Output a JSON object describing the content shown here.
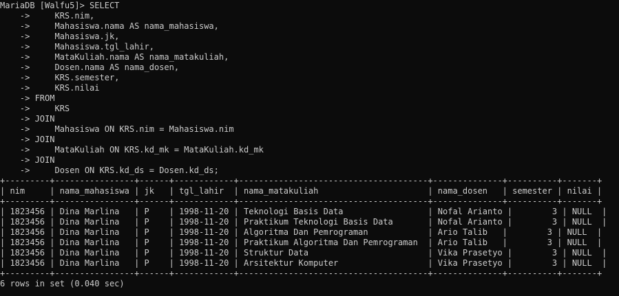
{
  "terminal": {
    "prompt": "MariaDB [Walfu5]> SELECT",
    "query_lines": [
      "    ->     KRS.nim,",
      "    ->     Mahasiswa.nama AS nama_mahasiswa,",
      "    ->     Mahasiswa.jk,",
      "    ->     Mahasiswa.tgl_lahir,",
      "    ->     MataKuliah.nama AS nama_matakuliah,",
      "    ->     Dosen.nama AS nama_dosen,",
      "    ->     KRS.semester,",
      "    ->     KRS.nilai",
      "    -> FROM",
      "    ->     KRS",
      "    -> JOIN",
      "    ->     Mahasiswa ON KRS.nim = Mahasiswa.nim",
      "    -> JOIN",
      "    ->     MataKuliah ON KRS.kd_mk = MataKuliah.kd_mk",
      "    -> JOIN",
      "    ->     Dosen ON KRS.kd_ds = Dosen.kd_ds;"
    ],
    "table_border": "+---------+----------------+------+------------+--------------------------------------+--------------+----------+-------+",
    "table_header": "| nim     | nama_mahasiswa | jk   | tgl_lahir  | nama_matakuliah                      | nama_dosen   | semester | nilai |",
    "table_rows": [
      "| 1823456 | Dina Marlina   | P    | 1998-11-20 | Teknologi Basis Data                 | Nofal Arianto |        3 | NULL  |",
      "| 1823456 | Dina Marlina   | P    | 1998-11-20 | Praktikum Teknologi Basis Data       | Nofal Arianto |        3 | NULL  |",
      "| 1823456 | Dina Marlina   | P    | 1998-11-20 | Algoritma Dan Pemrograman            | Ario Talib   |        3 | NULL  |",
      "| 1823456 | Dina Marlina   | P    | 1998-11-20 | Praktikum Algoritma Dan Pemrograman  | Ario Talib   |        3 | NULL  |",
      "| 1823456 | Dina Marlina   | P    | 1998-11-20 | Struktur Data                        | Vika Prasetyo |        3 | NULL  |",
      "| 1823456 | Dina Marlina   | P    | 1998-11-20 | Arsitektur Komputer                  | Vika Prasetyo |        3 | NULL  |"
    ],
    "result_summary": "6 rows in set (0.040 sec)"
  }
}
